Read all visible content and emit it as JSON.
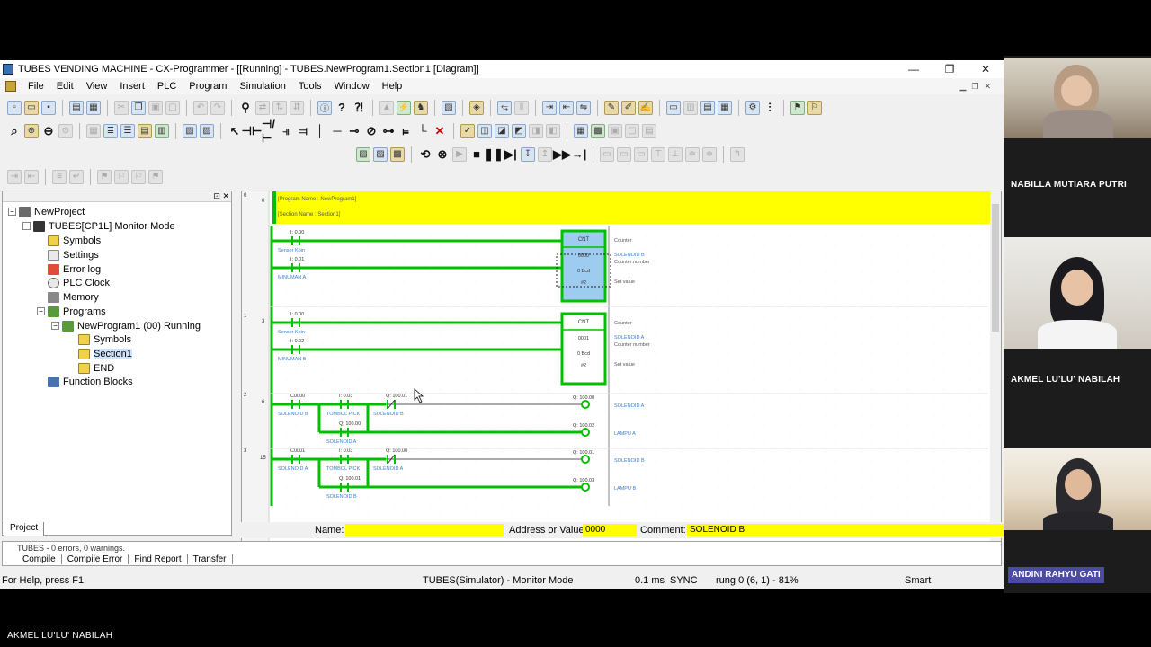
{
  "window": {
    "title": "TUBES VENDING MACHINE - CX-Programmer - [[Running] - TUBES.NewProgram1.Section1 [Diagram]]",
    "minimize": "—",
    "maximize": "❐",
    "close": "✕"
  },
  "menubar": [
    "File",
    "Edit",
    "View",
    "Insert",
    "PLC",
    "Program",
    "Simulation",
    "Tools",
    "Window",
    "Help"
  ],
  "tree": {
    "nodes": [
      {
        "label": "NewProject",
        "icon": "project-icon"
      },
      {
        "label": "TUBES[CP1L] Monitor Mode",
        "icon": "plc-icon"
      },
      {
        "label": "Symbols",
        "icon": "symbols-icon"
      },
      {
        "label": "Settings",
        "icon": "settings-icon"
      },
      {
        "label": "Error log",
        "icon": "error-log-icon"
      },
      {
        "label": "PLC Clock",
        "icon": "clock-icon"
      },
      {
        "label": "Memory",
        "icon": "memory-icon"
      },
      {
        "label": "Programs",
        "icon": "programs-icon"
      },
      {
        "label": "NewProgram1 (00) Running",
        "icon": "program-icon"
      },
      {
        "label": "Symbols",
        "icon": "symbols-icon"
      },
      {
        "label": "Section1",
        "icon": "section-icon"
      },
      {
        "label": "END",
        "icon": "section-icon"
      },
      {
        "label": "Function Blocks",
        "icon": "function-blocks-icon"
      }
    ],
    "tab": "Project"
  },
  "diagram": {
    "header_lines": [
      "[Program Name : NewProgram1]",
      "[Section Name : Section1]"
    ],
    "rung_numbers": [
      "0",
      "0",
      "1",
      "3",
      "2",
      "6",
      "3",
      "15"
    ],
    "contacts": [
      {
        "addr": "I: 0.00",
        "name": "Sensor Koin"
      },
      {
        "addr": "I: 0.01",
        "name": "MINUMAN A"
      },
      {
        "addr": "I: 0.00",
        "name": "Sensor Koin"
      },
      {
        "addr": "I: 0.02",
        "name": "MINUMAN B"
      },
      {
        "addr": "C0000",
        "name": "SOLENOID B"
      },
      {
        "addr": "I: 0.03",
        "name": "TOMBOL PICK"
      },
      {
        "addr": "Q: 100.01",
        "name": "SOLENOID B"
      },
      {
        "addr": "Q: 100.00",
        "name": "SOLENOID A"
      },
      {
        "addr": "C0001",
        "name": "SOLENOID A"
      },
      {
        "addr": "I: 0.03",
        "name": "TOMBOL PICK"
      },
      {
        "addr": "Q: 100.00",
        "name": "SOLENOID A"
      },
      {
        "addr": "Q: 100.01",
        "name": "SOLENOID B"
      }
    ],
    "counters": [
      {
        "label": "CNT",
        "number": "0000",
        "set": "0 Bcd",
        "value": "#2"
      },
      {
        "label": "CNT",
        "number": "0001",
        "set": "0 Bcd",
        "value": "#2"
      }
    ],
    "counter_notes": [
      [
        "Counter",
        "SOLENOID B",
        "Counter number",
        "Set value"
      ],
      [
        "Counter",
        "SOLENOID A",
        "Counter number",
        "Set value"
      ]
    ],
    "coils": [
      {
        "addr": "Q: 100.00",
        "name": "SOLENOID A"
      },
      {
        "addr": "Q: 100.02",
        "name": "LAMPU A"
      },
      {
        "addr": "Q: 100.01",
        "name": "SOLENOID B"
      },
      {
        "addr": "Q: 100.03",
        "name": "LAMPU B"
      }
    ]
  },
  "infobar": {
    "name_label": "Name:",
    "name_value": "",
    "address_label": "Address or Value:",
    "address_value": "0000",
    "comment_label": "Comment:",
    "comment_value": "SOLENOID B"
  },
  "output": {
    "log": "TUBES - 0 errors, 0 warnings.",
    "tabs": [
      "Compile",
      "Compile Error",
      "Find Report",
      "Transfer"
    ]
  },
  "status": {
    "help": "For Help, press F1",
    "mode": "TUBES(Simulator) - Monitor Mode",
    "cycle": "0.1 ms",
    "sync": "SYNC",
    "rung": "rung 0 (6, 1) - 81%",
    "smart": "Smart"
  },
  "participants": [
    {
      "name": "NABILLA MUTIARA PUTRI"
    },
    {
      "name": "AKMEL LU'LU' NABILAH"
    },
    {
      "name": "ANDINI RAHYU GATI"
    }
  ],
  "bottom_caption": "AKMEL LU'LU' NABILAH",
  "colors": {
    "rung_green": "#00c000",
    "header_yellow": "#ffff00",
    "label_blue": "#3a7fd0"
  }
}
